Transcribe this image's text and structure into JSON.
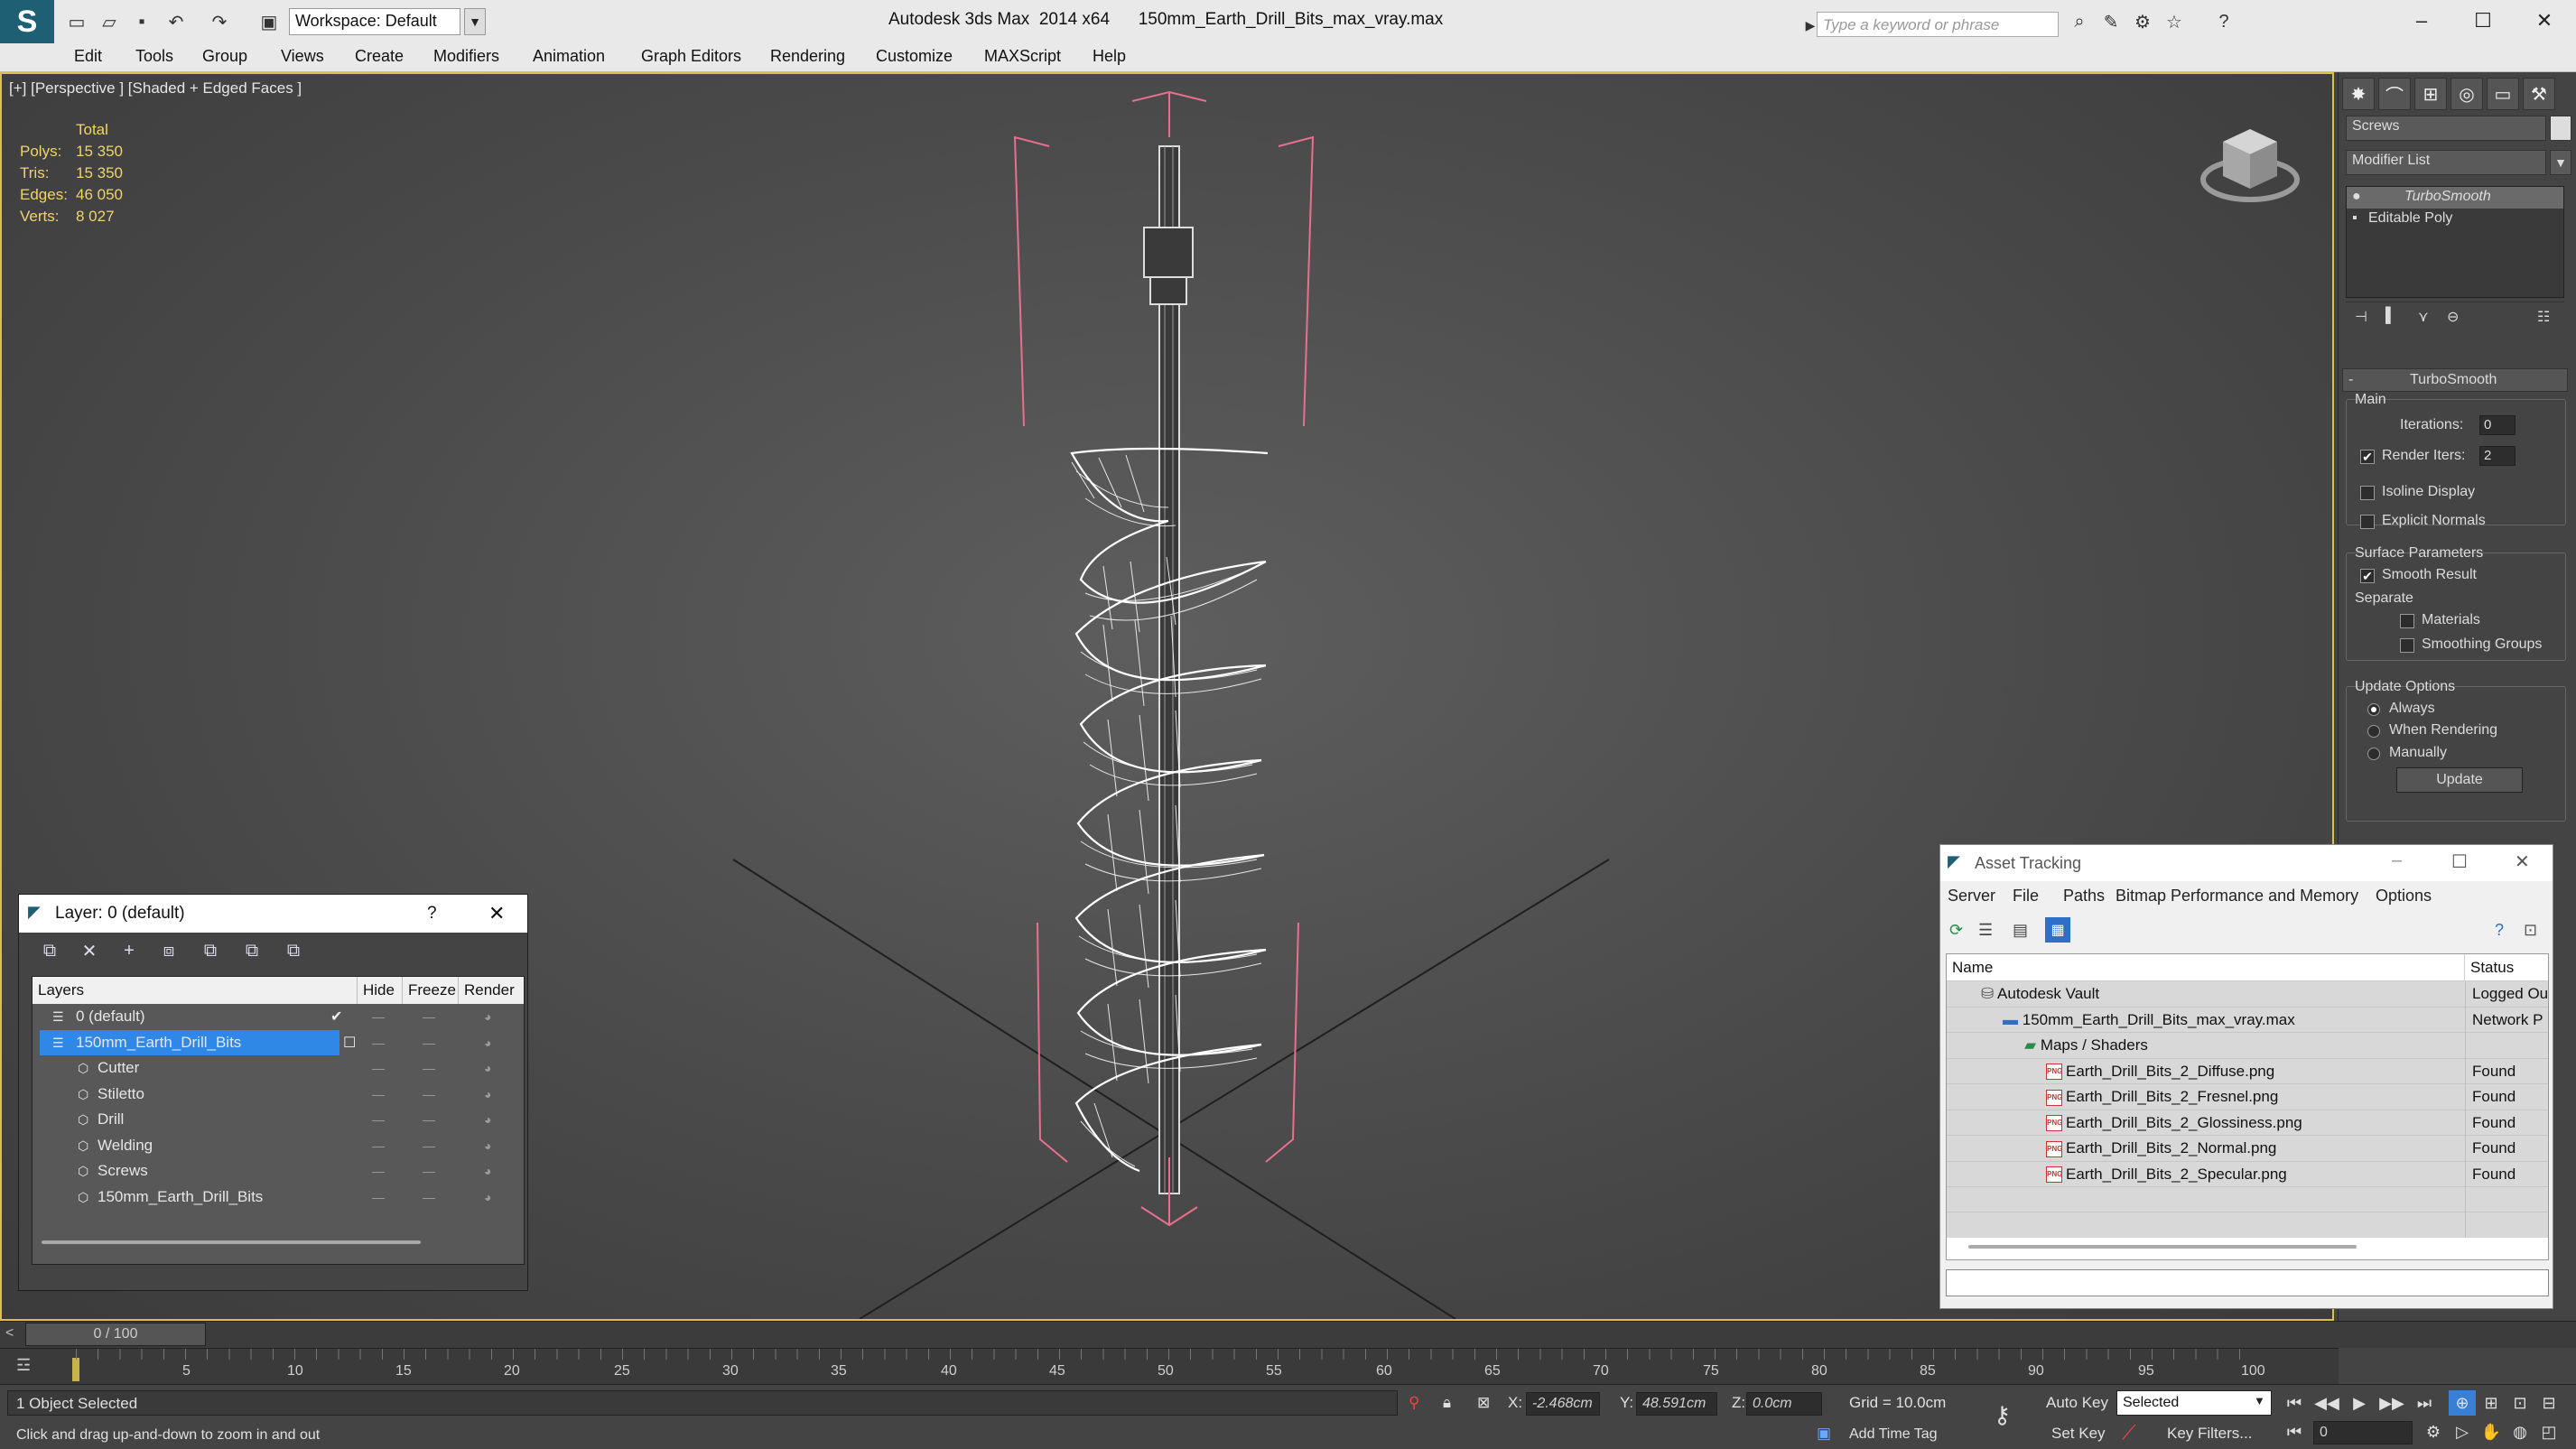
{
  "titlebar": {
    "workspace": "Workspace: Default",
    "title": "Autodesk 3ds Max  2014 x64      150mm_Earth_Drill_Bits_max_vray.max",
    "search_placeholder": "Type a keyword or phrase"
  },
  "menu": [
    "Edit",
    "Tools",
    "Group",
    "Views",
    "Create",
    "Modifiers",
    "Animation",
    "Graph Editors",
    "Rendering",
    "Customize",
    "MAXScript",
    "Help"
  ],
  "viewport": {
    "label": "[+] [Perspective ] [Shaded + Edged Faces ]",
    "stats": {
      "header": "Total",
      "rows": [
        {
          "label": "Polys:",
          "value": "15 350"
        },
        {
          "label": "Tris:",
          "value": "15 350"
        },
        {
          "label": "Edges:",
          "value": "46 050"
        },
        {
          "label": "Verts:",
          "value": "8 027"
        }
      ]
    }
  },
  "command_panel": {
    "object_name": "Screws",
    "modifier_list": "Modifier List",
    "stack": [
      "TurboSmooth",
      "Editable Poly"
    ],
    "rollout_title": "TurboSmooth",
    "main_label": "Main",
    "iterations_label": "Iterations:",
    "iterations_value": "0",
    "render_iters_label": "Render Iters:",
    "render_iters_value": "2",
    "isoline": "Isoline Display",
    "explicit_normals": "Explicit Normals",
    "surface_params": "Surface Parameters",
    "smooth_result": "Smooth Result",
    "separate": "Separate",
    "materials": "Materials",
    "smoothing_groups": "Smoothing Groups",
    "update_options": "Update Options",
    "always": "Always",
    "when_rendering": "When Rendering",
    "manually": "Manually",
    "update_button": "Update"
  },
  "layer_dialog": {
    "title": "Layer: 0 (default)",
    "help": "?",
    "columns": [
      "Layers",
      "Hide",
      "Freeze",
      "Render"
    ],
    "rows": [
      {
        "name": "0 (default)",
        "indent": 0
      },
      {
        "name": "150mm_Earth_Drill_Bits",
        "indent": 0
      },
      {
        "name": "Cutter",
        "indent": 1
      },
      {
        "name": "Stiletto",
        "indent": 1
      },
      {
        "name": "Drill",
        "indent": 1
      },
      {
        "name": "Welding",
        "indent": 1
      },
      {
        "name": "Screws",
        "indent": 1
      },
      {
        "name": "150mm_Earth_Drill_Bits",
        "indent": 1
      }
    ],
    "cell_mark": "—"
  },
  "asset_tracking": {
    "title": "Asset Tracking",
    "menu": [
      "Server",
      "File",
      "Paths",
      "Bitmap Performance and Memory",
      "Options"
    ],
    "columns": [
      "Name",
      "Status"
    ],
    "rows": [
      {
        "name": "Autodesk Vault",
        "status": "Logged Ou",
        "indent": 0,
        "icon": "vault"
      },
      {
        "name": "150mm_Earth_Drill_Bits_max_vray.max",
        "status": "Network P",
        "indent": 1,
        "icon": "max"
      },
      {
        "name": "Maps / Shaders",
        "status": "",
        "indent": 2,
        "icon": "maps"
      },
      {
        "name": "Earth_Drill_Bits_2_Diffuse.png",
        "status": "Found",
        "indent": 3,
        "icon": "png"
      },
      {
        "name": "Earth_Drill_Bits_2_Fresnel.png",
        "status": "Found",
        "indent": 3,
        "icon": "png"
      },
      {
        "name": "Earth_Drill_Bits_2_Glossiness.png",
        "status": "Found",
        "indent": 3,
        "icon": "png"
      },
      {
        "name": "Earth_Drill_Bits_2_Normal.png",
        "status": "Found",
        "indent": 3,
        "icon": "png"
      },
      {
        "name": "Earth_Drill_Bits_2_Specular.png",
        "status": "Found",
        "indent": 3,
        "icon": "png"
      }
    ],
    "png_badge": "PNG"
  },
  "timeline": {
    "frame": "0 / 100",
    "ticks": [
      "5",
      "10",
      "15",
      "20",
      "25",
      "30",
      "35",
      "40",
      "45",
      "50",
      "55",
      "60",
      "65",
      "70",
      "75",
      "80",
      "85",
      "90",
      "95",
      "100"
    ]
  },
  "statusbar": {
    "selection": "1 Object Selected",
    "prompt": "Click and drag up-and-down to zoom in and out",
    "x_label": "X:",
    "x_value": "-2.468cm",
    "y_label": "Y:",
    "y_value": "48.591cm",
    "z_label": "Z:",
    "z_value": "0.0cm",
    "grid": "Grid = 10.0cm",
    "auto_key": "Auto Key",
    "selected": "Selected",
    "set_key": "Set Key",
    "key_filters": "Key Filters...",
    "add_time_tag": "Add Time Tag",
    "frame_value": "0"
  },
  "colors": {
    "accent_selection": "#2f87e6",
    "stats_text": "#f1d36b",
    "viewport_border": "#d9c24a",
    "gizmo": "#e8708e",
    "wireframe": "#ffffff"
  }
}
